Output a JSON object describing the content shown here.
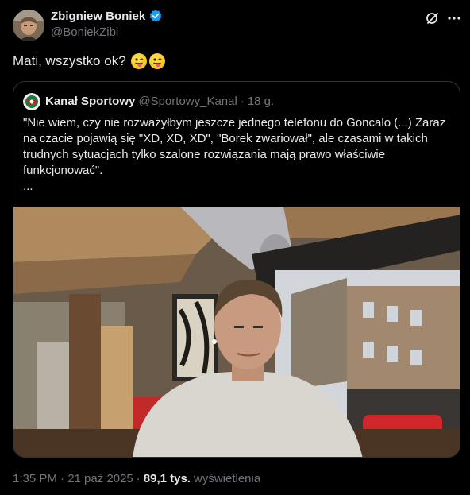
{
  "author": {
    "name": "Zbigniew Boniek",
    "handle": "@BoniekZibi"
  },
  "tweet": {
    "text": "Mati, wszystko ok?"
  },
  "quote": {
    "name": "Kanał Sportowy",
    "handle": "@Sportowy_Kanal",
    "separator": "·",
    "time": "18 g.",
    "text_lines": [
      "\"Nie wiem, czy nie rozważyłbym jeszcze jednego telefonu do Goncalo (...) Zaraz na czacie pojawią się \"XD, XD, XD\", \"Borek zwariował\", ale czasami w takich trudnych sytuacjach tylko szalone rozwiązania mają prawo właściwie funkcjonować\".",
      "..."
    ]
  },
  "meta": {
    "timestamp": "1:35 PM · 21 paź 2025",
    "separator": "·",
    "views_count": "89,1 tys.",
    "views_label": "wyświetlenia"
  },
  "icons": {
    "verified": "verified-badge-icon",
    "grok": "grok-icon",
    "more": "more-icon",
    "emoji": "winking-face-with-tongue"
  },
  "colors": {
    "background": "#000000",
    "text": "#e7e9ea",
    "secondary": "#71767b",
    "border": "#2f3336",
    "verified": "#1d9bf0"
  }
}
